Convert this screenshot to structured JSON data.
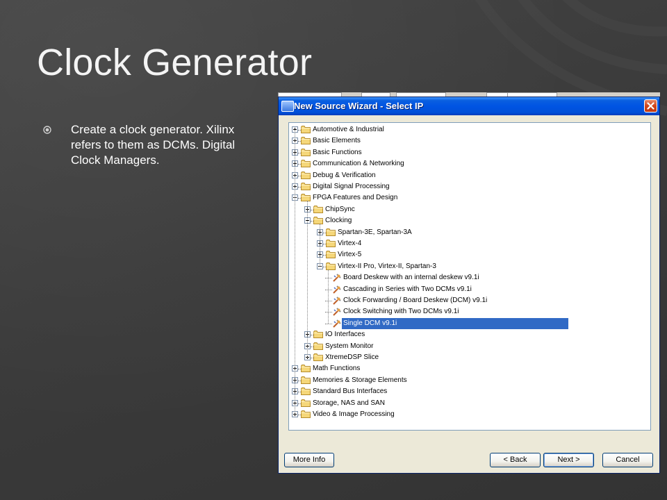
{
  "slide": {
    "title": "Clock Generator",
    "bullet": "Create a clock generator.  Xilinx refers to them as DCMs.  Digital Clock Managers."
  },
  "dialog": {
    "title": "New Source Wizard - Select IP",
    "icons": {
      "title": "wizard-icon",
      "close": "close-icon"
    },
    "tree": [
      {
        "label": "Automotive & Industrial",
        "depth": 0,
        "state": "collapsed",
        "icon": "folder-icon"
      },
      {
        "label": "Basic Elements",
        "depth": 0,
        "state": "collapsed",
        "icon": "folder-icon"
      },
      {
        "label": "Basic Functions",
        "depth": 0,
        "state": "collapsed",
        "icon": "folder-icon"
      },
      {
        "label": "Communication & Networking",
        "depth": 0,
        "state": "collapsed",
        "icon": "folder-icon"
      },
      {
        "label": "Debug & Verification",
        "depth": 0,
        "state": "collapsed",
        "icon": "folder-icon"
      },
      {
        "label": "Digital Signal Processing",
        "depth": 0,
        "state": "collapsed",
        "icon": "folder-icon"
      },
      {
        "label": "FPGA Features and Design",
        "depth": 0,
        "state": "expanded",
        "icon": "folder-icon"
      },
      {
        "label": "ChipSync",
        "depth": 1,
        "state": "collapsed",
        "icon": "folder-icon"
      },
      {
        "label": "Clocking",
        "depth": 1,
        "state": "expanded",
        "icon": "folder-icon"
      },
      {
        "label": "Spartan-3E, Spartan-3A",
        "depth": 2,
        "state": "collapsed",
        "icon": "folder-icon"
      },
      {
        "label": "Virtex-4",
        "depth": 2,
        "state": "collapsed",
        "icon": "folder-icon"
      },
      {
        "label": "Virtex-5",
        "depth": 2,
        "state": "collapsed",
        "icon": "folder-icon"
      },
      {
        "label": "Virtex-II Pro, Virtex-II, Spartan-3",
        "depth": 2,
        "state": "expanded",
        "icon": "folder-icon"
      },
      {
        "label": "Board Deskew with an internal deskew v9.1i",
        "depth": 3,
        "state": "leaf",
        "icon": "ip-core-icon"
      },
      {
        "label": "Cascading in Series with Two DCMs v9.1i",
        "depth": 3,
        "state": "leaf",
        "icon": "ip-core-icon"
      },
      {
        "label": "Clock Forwarding / Board Deskew (DCM) v9.1i",
        "depth": 3,
        "state": "leaf",
        "icon": "ip-core-icon"
      },
      {
        "label": "Clock Switching with Two DCMs v9.1i",
        "depth": 3,
        "state": "leaf",
        "icon": "ip-core-icon"
      },
      {
        "label": "Single DCM v9.1i",
        "depth": 3,
        "state": "leaf",
        "icon": "ip-core-icon",
        "selected": true
      },
      {
        "label": "IO Interfaces",
        "depth": 1,
        "state": "collapsed",
        "icon": "folder-icon"
      },
      {
        "label": "System Monitor",
        "depth": 1,
        "state": "collapsed",
        "icon": "folder-icon"
      },
      {
        "label": "XtremeDSP Slice",
        "depth": 1,
        "state": "collapsed",
        "icon": "folder-icon"
      },
      {
        "label": "Math Functions",
        "depth": 0,
        "state": "collapsed",
        "icon": "folder-icon"
      },
      {
        "label": "Memories & Storage Elements",
        "depth": 0,
        "state": "collapsed",
        "icon": "folder-icon"
      },
      {
        "label": "Standard Bus Interfaces",
        "depth": 0,
        "state": "collapsed",
        "icon": "folder-icon"
      },
      {
        "label": "Storage, NAS and SAN",
        "depth": 0,
        "state": "collapsed",
        "icon": "folder-icon"
      },
      {
        "label": "Video & Image Processing",
        "depth": 0,
        "state": "collapsed",
        "icon": "folder-icon"
      }
    ],
    "buttons": {
      "more_info": "More Info",
      "back": "< Back",
      "next": "Next >",
      "cancel": "Cancel"
    }
  },
  "colors": {
    "slide_background": "#3a3a3a",
    "title_text": "#f4f4f4",
    "selection": "#316ac5",
    "titlebar": "#0054e3"
  }
}
